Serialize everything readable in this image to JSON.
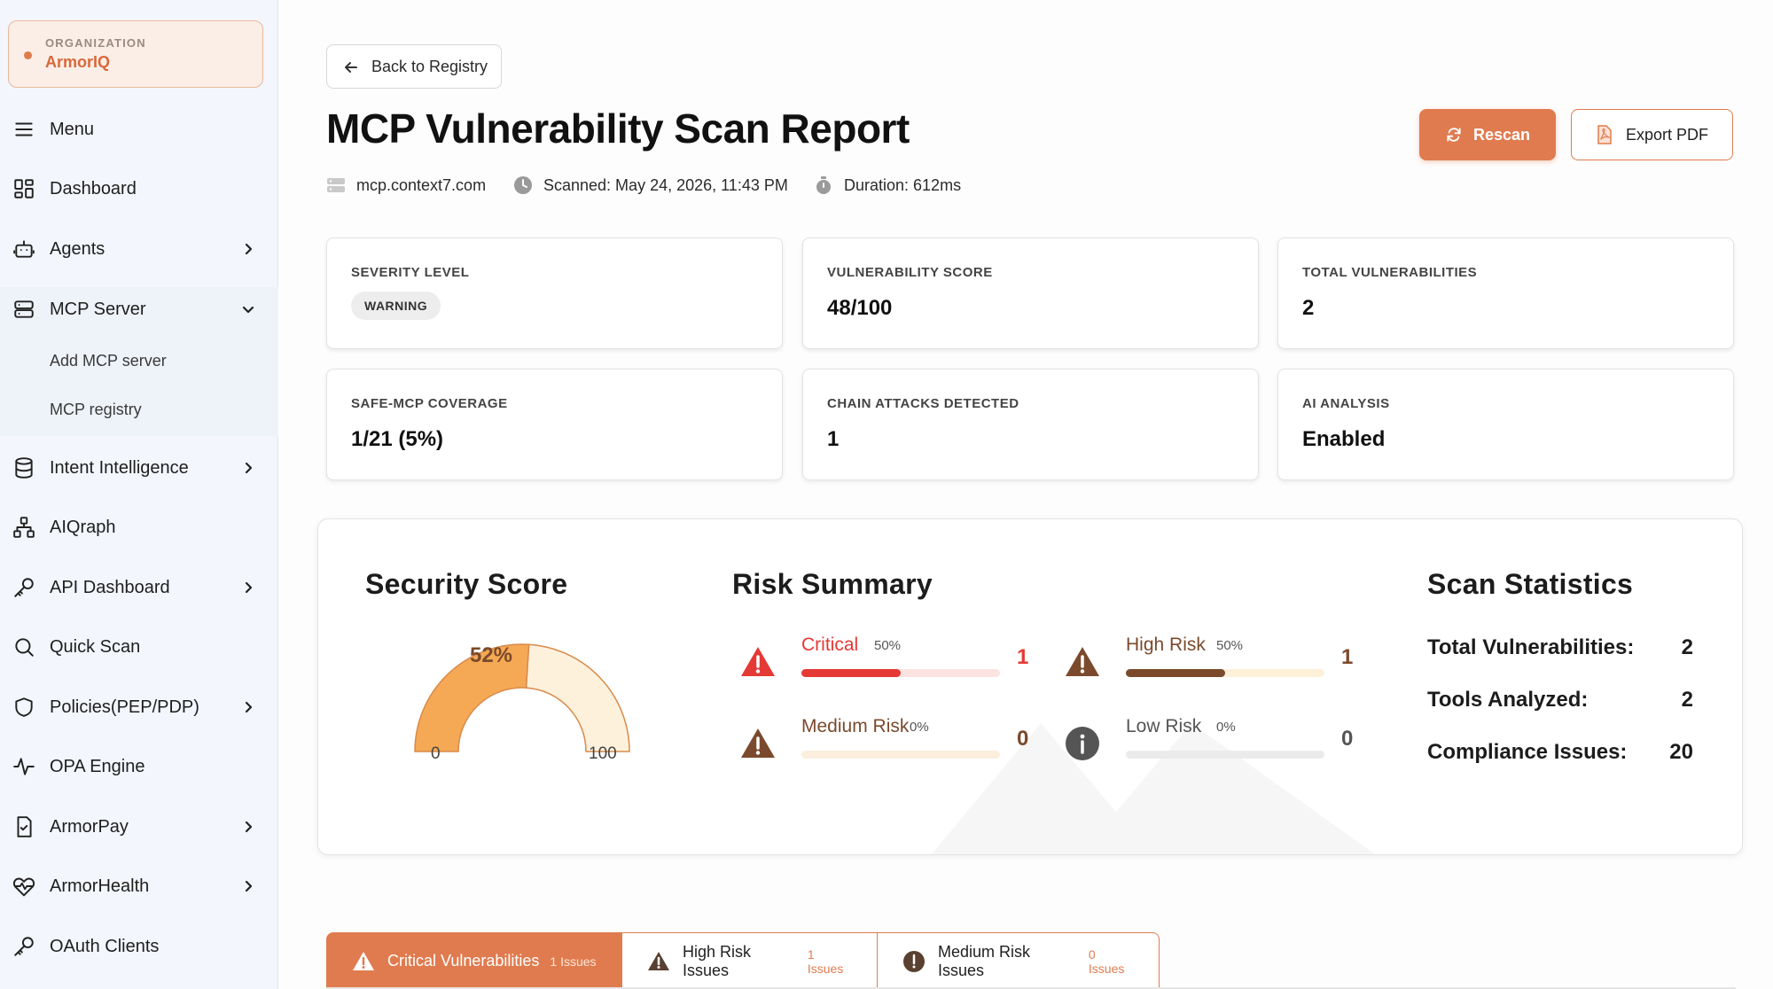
{
  "org": {
    "label": "ORGANIZATION",
    "name": "ArmorIQ"
  },
  "nav": {
    "menu": "Menu",
    "dashboard": "Dashboard",
    "agents": "Agents",
    "mcp_server": "MCP Server",
    "add_mcp": "Add MCP server",
    "mcp_registry": "MCP registry",
    "intent": "Intent Intelligence",
    "aiqraph": "AIQraph",
    "api_dashboard": "API Dashboard",
    "quick_scan": "Quick Scan",
    "policies": "Policies(PEP/PDP)",
    "opa": "OPA Engine",
    "armorpay": "ArmorPay",
    "armorhealth": "ArmorHealth",
    "oauth": "OAuth Clients"
  },
  "header": {
    "back": "Back to Registry",
    "title": "MCP Vulnerability Scan Report",
    "host": "mcp.context7.com",
    "scanned": "Scanned: May 24, 2026, 11:43 PM",
    "duration": "Duration: 612ms",
    "rescan": "Rescan",
    "export": "Export PDF"
  },
  "cards": {
    "severity_label": "SEVERITY LEVEL",
    "severity_value": "WARNING",
    "vuln_score_label": "VULNERABILITY SCORE",
    "vuln_score_value": "48/100",
    "total_label": "TOTAL VULNERABILITIES",
    "total_value": "2",
    "coverage_label": "SAFE-MCP COVERAGE",
    "coverage_value": "1/21 (5%)",
    "chain_label": "CHAIN ATTACKS DETECTED",
    "chain_value": "1",
    "ai_label": "AI ANALYSIS",
    "ai_value": "Enabled"
  },
  "security_score": {
    "title": "Security Score",
    "value_text": "52%",
    "value": 52,
    "min": "0",
    "max": "100",
    "colors": {
      "filled": "#f5a955",
      "empty": "#fdf1dc",
      "stroke": "#d98a4a"
    }
  },
  "risk_summary": {
    "title": "Risk Summary",
    "items": [
      {
        "name": "Critical",
        "pct": "50%",
        "fraction": 0.5,
        "count": "1",
        "color": "#e53935",
        "track": "#fbe3e0"
      },
      {
        "name": "High Risk",
        "pct": "50%",
        "fraction": 0.5,
        "count": "1",
        "color": "#7b4a2c",
        "track": "#fdf0d8"
      },
      {
        "name": "Medium Risk",
        "pct": "0%",
        "fraction": 0,
        "count": "0",
        "color": "#7b4a2c",
        "track": "#fbeedd"
      },
      {
        "name": "Low Risk",
        "pct": "0%",
        "fraction": 0,
        "count": "0",
        "color": "#555555",
        "track": "#ebebeb"
      }
    ]
  },
  "scan_stats": {
    "title": "Scan Statistics",
    "total_label": "Total Vulnerabilities:",
    "total_value": "2",
    "tools_label": "Tools Analyzed:",
    "tools_value": "2",
    "compliance_label": "Compliance Issues:",
    "compliance_value": "20"
  },
  "tabs": [
    {
      "label": "Critical Vulnerabilities",
      "count": "1 Issues"
    },
    {
      "label": "High Risk Issues",
      "count": "1 Issues"
    },
    {
      "label": "Medium Risk Issues",
      "count": "0 Issues"
    }
  ],
  "accent": "#e07b4f"
}
